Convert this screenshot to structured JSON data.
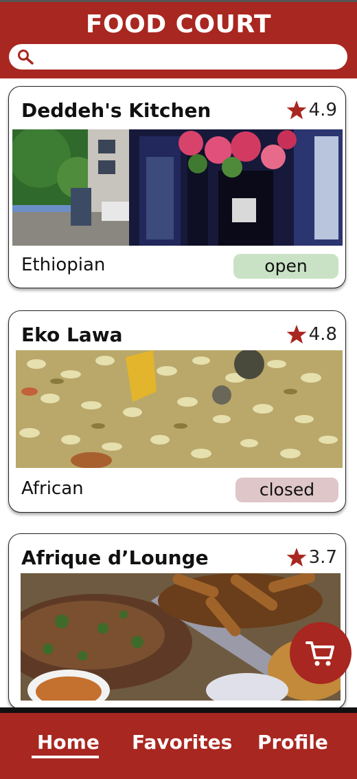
{
  "header": {
    "title": "FOOD COURT"
  },
  "search": {
    "value": "",
    "icon": "search-icon"
  },
  "restaurants": [
    {
      "name": "Deddeh's Kitchen",
      "rating": "4.9",
      "cuisine": "Ethiopian",
      "status": "open",
      "status_color": "#c9e2c5"
    },
    {
      "name": "Eko Lawa",
      "rating": "4.8",
      "cuisine": "African",
      "status": "closed",
      "status_color": "#dfc6c9"
    },
    {
      "name": "Afrique d’Lounge",
      "rating": "3.7"
    }
  ],
  "cart": {
    "icon": "cart-icon"
  },
  "nav": {
    "home": "Home",
    "favorites": "Favorites",
    "profile": "Profile",
    "active": "Home"
  },
  "colors": {
    "brand": "#a82720",
    "star": "#a82720"
  }
}
